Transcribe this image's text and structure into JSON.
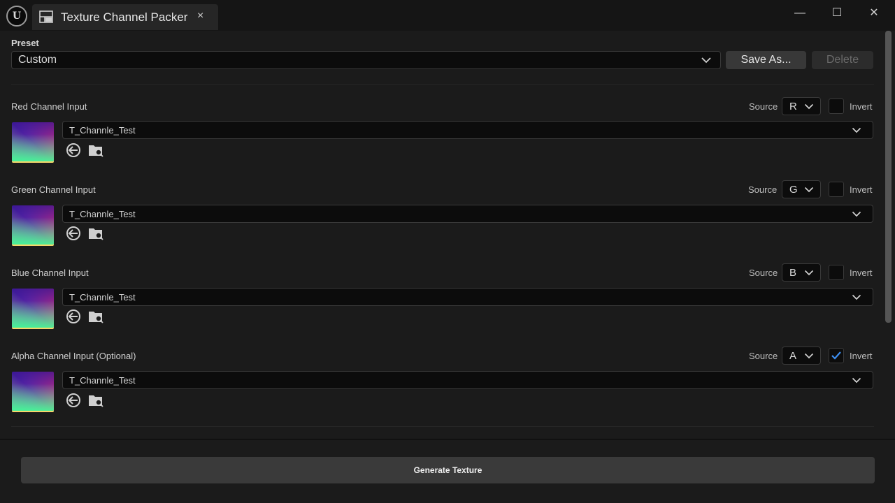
{
  "window": {
    "tab_title": "Texture Channel Packer",
    "close_tab_glyph": "×",
    "minimize_glyph": "—",
    "maximize_glyph": "☐",
    "close_glyph": "✕"
  },
  "preset": {
    "label": "Preset",
    "value": "Custom",
    "save_as_label": "Save As...",
    "delete_label": "Delete"
  },
  "channels": [
    {
      "label": "Red Channel Input",
      "source_label": "Source",
      "source": "R",
      "invert_label": "Invert",
      "invert": false,
      "asset": "T_Channle_Test"
    },
    {
      "label": "Green Channel Input",
      "source_label": "Source",
      "source": "G",
      "invert_label": "Invert",
      "invert": false,
      "asset": "T_Channle_Test"
    },
    {
      "label": "Blue Channel Input",
      "source_label": "Source",
      "source": "B",
      "invert_label": "Invert",
      "invert": false,
      "asset": "T_Channle_Test"
    },
    {
      "label": "Alpha Channel Input (Optional)",
      "source_label": "Source",
      "source": "A",
      "invert_label": "Invert",
      "invert": true,
      "asset": "T_Channle_Test"
    }
  ],
  "generate_label": "Generate Texture",
  "colors": {
    "accent_check": "#3d8ef0"
  }
}
